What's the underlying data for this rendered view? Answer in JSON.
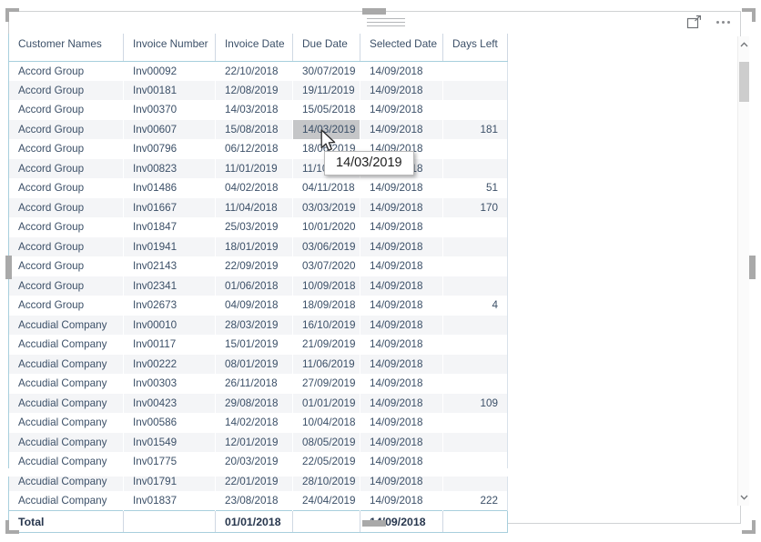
{
  "visual": {
    "drag_handle_label": "drag-handle",
    "focus_mode_label": "Focus mode",
    "more_options_label": "More options"
  },
  "table": {
    "columns": [
      "Customer Names",
      "Invoice Number",
      "Invoice Date",
      "Due Date",
      "Selected Date",
      "Days Left"
    ],
    "rows": [
      [
        "Accord Group",
        "Inv00092",
        "22/10/2018",
        "30/07/2019",
        "14/09/2018",
        ""
      ],
      [
        "Accord Group",
        "Inv00181",
        "12/08/2019",
        "19/11/2019",
        "14/09/2018",
        ""
      ],
      [
        "Accord Group",
        "Inv00370",
        "14/03/2018",
        "15/05/2018",
        "14/09/2018",
        ""
      ],
      [
        "Accord Group",
        "Inv00607",
        "15/08/2018",
        "14/03/2019",
        "14/09/2018",
        "181"
      ],
      [
        "Accord Group",
        "Inv00796",
        "06/12/2018",
        "18/06/2019",
        "14/09/2018",
        ""
      ],
      [
        "Accord Group",
        "Inv00823",
        "11/01/2019",
        "11/10/2019",
        "14/09/2018",
        ""
      ],
      [
        "Accord Group",
        "Inv01486",
        "04/02/2018",
        "04/11/2018",
        "14/09/2018",
        "51"
      ],
      [
        "Accord Group",
        "Inv01667",
        "11/04/2018",
        "03/03/2019",
        "14/09/2018",
        "170"
      ],
      [
        "Accord Group",
        "Inv01847",
        "25/03/2019",
        "10/01/2020",
        "14/09/2018",
        ""
      ],
      [
        "Accord Group",
        "Inv01941",
        "18/01/2019",
        "03/06/2019",
        "14/09/2018",
        ""
      ],
      [
        "Accord Group",
        "Inv02143",
        "22/09/2019",
        "03/07/2020",
        "14/09/2018",
        ""
      ],
      [
        "Accord Group",
        "Inv02341",
        "01/06/2018",
        "10/09/2018",
        "14/09/2018",
        ""
      ],
      [
        "Accord Group",
        "Inv02673",
        "04/09/2018",
        "18/09/2018",
        "14/09/2018",
        "4"
      ],
      [
        "Accudial Company",
        "Inv00010",
        "28/03/2019",
        "16/10/2019",
        "14/09/2018",
        ""
      ],
      [
        "Accudial Company",
        "Inv00117",
        "15/01/2019",
        "21/09/2019",
        "14/09/2018",
        ""
      ],
      [
        "Accudial Company",
        "Inv00222",
        "08/01/2019",
        "11/06/2019",
        "14/09/2018",
        ""
      ],
      [
        "Accudial Company",
        "Inv00303",
        "26/11/2018",
        "27/09/2019",
        "14/09/2018",
        ""
      ],
      [
        "Accudial Company",
        "Inv00423",
        "29/08/2018",
        "01/01/2019",
        "14/09/2018",
        "109"
      ],
      [
        "Accudial Company",
        "Inv00586",
        "14/02/2018",
        "10/04/2018",
        "14/09/2018",
        ""
      ],
      [
        "Accudial Company",
        "Inv01549",
        "12/01/2019",
        "08/05/2019",
        "14/09/2018",
        ""
      ],
      [
        "Accudial Company",
        "Inv01775",
        "20/03/2019",
        "22/05/2019",
        "14/09/2018",
        ""
      ],
      [
        "Accudial Company",
        "Inv01791",
        "22/01/2019",
        "28/10/2019",
        "14/09/2018",
        ""
      ],
      [
        "Accudial Company",
        "Inv01837",
        "23/08/2018",
        "24/04/2019",
        "14/09/2018",
        "222"
      ]
    ],
    "highlighted_cell": {
      "row": 3,
      "col": 3
    },
    "total_row": [
      "Total",
      "",
      "01/01/2018",
      "",
      "14/09/2018",
      ""
    ]
  },
  "tooltip": {
    "text": "14/03/2019"
  },
  "scrollbar": {
    "up_arrow": "⌃",
    "down_arrow": "⌄"
  },
  "colors": {
    "header_rule": "#a8cfdd",
    "text": "#3c5068",
    "alt_row": "#f4f5f7",
    "highlight": "#c5c6c8"
  }
}
